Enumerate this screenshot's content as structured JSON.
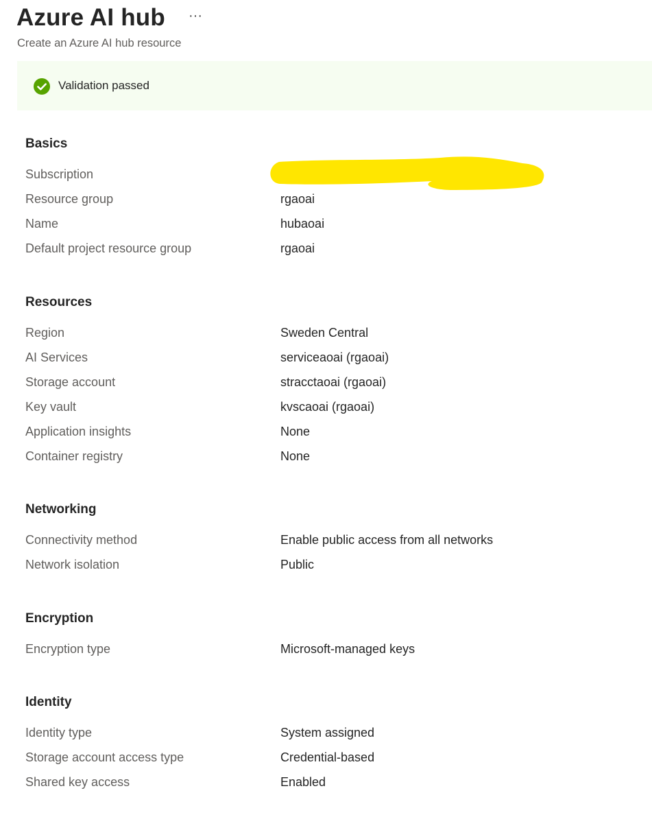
{
  "header": {
    "title": "Azure AI hub",
    "more_label": "···",
    "subtitle": "Create an Azure AI hub resource"
  },
  "banner": {
    "icon": "checkmark-circle-icon",
    "status_color": "#57a300",
    "message": "Validation passed"
  },
  "sections": {
    "basics": {
      "title": "Basics",
      "rows": [
        {
          "label": "Subscription",
          "value": ""
        },
        {
          "label": "Resource group",
          "value": "rgaoai"
        },
        {
          "label": "Name",
          "value": "hubaoai"
        },
        {
          "label": "Default project resource group",
          "value": "rgaoai"
        }
      ]
    },
    "resources": {
      "title": "Resources",
      "rows": [
        {
          "label": "Region",
          "value": "Sweden Central"
        },
        {
          "label": "AI Services",
          "value": "serviceaoai (rgaoai)"
        },
        {
          "label": "Storage account",
          "value": "stracctaoai (rgaoai)"
        },
        {
          "label": "Key vault",
          "value": "kvscaoai (rgaoai)"
        },
        {
          "label": "Application insights",
          "value": "None"
        },
        {
          "label": "Container registry",
          "value": "None"
        }
      ]
    },
    "networking": {
      "title": "Networking",
      "rows": [
        {
          "label": "Connectivity method",
          "value": "Enable public access from all networks"
        },
        {
          "label": "Network isolation",
          "value": "Public"
        }
      ]
    },
    "encryption": {
      "title": "Encryption",
      "rows": [
        {
          "label": "Encryption type",
          "value": "Microsoft-managed keys"
        }
      ]
    },
    "identity": {
      "title": "Identity",
      "rows": [
        {
          "label": "Identity type",
          "value": "System assigned"
        },
        {
          "label": "Storage account access type",
          "value": "Credential-based"
        },
        {
          "label": "Shared key access",
          "value": "Enabled"
        }
      ]
    }
  },
  "redaction": {
    "color": "#ffe600"
  }
}
